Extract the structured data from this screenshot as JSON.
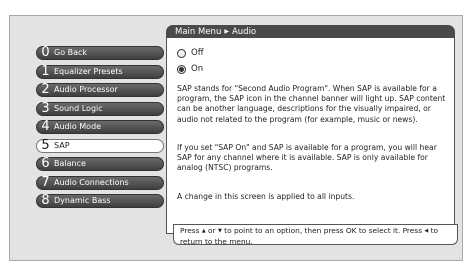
{
  "breadcrumb": {
    "root": "Main Menu",
    "separator_icon": "right-triangle",
    "current": "Audio"
  },
  "menu": [
    {
      "num": "0",
      "label": "Go Back"
    },
    {
      "num": "1",
      "label": "Equalizer Presets"
    },
    {
      "num": "2",
      "label": "Audio Processor"
    },
    {
      "num": "3",
      "label": "Sound Logic"
    },
    {
      "num": "4",
      "label": "Audio Mode"
    },
    {
      "num": "5",
      "label": "SAP",
      "selected": true
    },
    {
      "num": "6",
      "label": "Balance"
    },
    {
      "num": "7",
      "label": "Audio Connections"
    },
    {
      "num": "8",
      "label": "Dynamic Bass"
    }
  ],
  "options": [
    {
      "label": "Off",
      "selected": false
    },
    {
      "label": "On",
      "selected": true
    }
  ],
  "description": {
    "p1": "SAP stands for \"Second Audio Program\".  When SAP is available for a program, the SAP icon in the channel banner will light up. SAP content can be another language, descriptions for the visually impaired, or audio not related to the program (for example, music or news).",
    "p2": "If you set \"SAP On\" and SAP is available for a program, you will hear SAP for any channel where it is available. SAP is only available for analog (NTSC) programs.",
    "p3": "A change in this screen is applied to all inputs."
  },
  "help": {
    "t1": "Press",
    "up": "▲",
    "t2": "or",
    "down": "▼",
    "t3": "to point to an option, then press OK to select it. Press",
    "left": "◀",
    "t4": "to return to the menu."
  }
}
